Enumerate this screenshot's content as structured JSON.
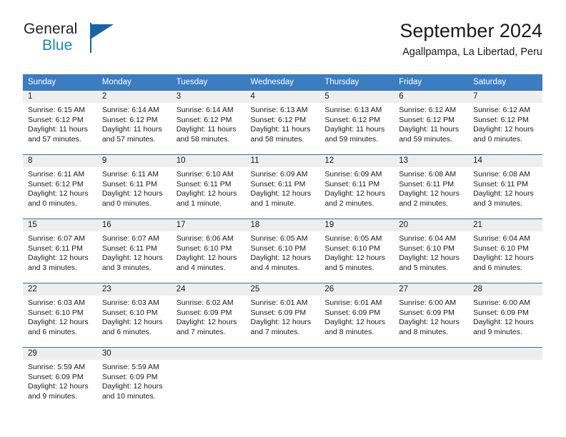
{
  "brand": {
    "name_line1": "General",
    "name_line2": "Blue",
    "logo_icon": "triangle-flag-icon",
    "accent_color": "#1565a8",
    "blue_text_color": "#1f7fc4"
  },
  "header": {
    "title": "September 2024",
    "subtitle": "Agallpampa, La Libertad, Peru"
  },
  "theme": {
    "header_row_color": "#3b7dc0",
    "day_band_color": "#eeeeee",
    "row_divider_color": "#2f6fb3"
  },
  "weekdays": [
    "Sunday",
    "Monday",
    "Tuesday",
    "Wednesday",
    "Thursday",
    "Friday",
    "Saturday"
  ],
  "weeks": [
    [
      {
        "day": "1",
        "sunrise": "Sunrise: 6:15 AM",
        "sunset": "Sunset: 6:12 PM",
        "daylight": "Daylight: 11 hours and 57 minutes."
      },
      {
        "day": "2",
        "sunrise": "Sunrise: 6:14 AM",
        "sunset": "Sunset: 6:12 PM",
        "daylight": "Daylight: 11 hours and 57 minutes."
      },
      {
        "day": "3",
        "sunrise": "Sunrise: 6:14 AM",
        "sunset": "Sunset: 6:12 PM",
        "daylight": "Daylight: 11 hours and 58 minutes."
      },
      {
        "day": "4",
        "sunrise": "Sunrise: 6:13 AM",
        "sunset": "Sunset: 6:12 PM",
        "daylight": "Daylight: 11 hours and 58 minutes."
      },
      {
        "day": "5",
        "sunrise": "Sunrise: 6:13 AM",
        "sunset": "Sunset: 6:12 PM",
        "daylight": "Daylight: 11 hours and 59 minutes."
      },
      {
        "day": "6",
        "sunrise": "Sunrise: 6:12 AM",
        "sunset": "Sunset: 6:12 PM",
        "daylight": "Daylight: 11 hours and 59 minutes."
      },
      {
        "day": "7",
        "sunrise": "Sunrise: 6:12 AM",
        "sunset": "Sunset: 6:12 PM",
        "daylight": "Daylight: 12 hours and 0 minutes."
      }
    ],
    [
      {
        "day": "8",
        "sunrise": "Sunrise: 6:11 AM",
        "sunset": "Sunset: 6:12 PM",
        "daylight": "Daylight: 12 hours and 0 minutes."
      },
      {
        "day": "9",
        "sunrise": "Sunrise: 6:11 AM",
        "sunset": "Sunset: 6:11 PM",
        "daylight": "Daylight: 12 hours and 0 minutes."
      },
      {
        "day": "10",
        "sunrise": "Sunrise: 6:10 AM",
        "sunset": "Sunset: 6:11 PM",
        "daylight": "Daylight: 12 hours and 1 minute."
      },
      {
        "day": "11",
        "sunrise": "Sunrise: 6:09 AM",
        "sunset": "Sunset: 6:11 PM",
        "daylight": "Daylight: 12 hours and 1 minute."
      },
      {
        "day": "12",
        "sunrise": "Sunrise: 6:09 AM",
        "sunset": "Sunset: 6:11 PM",
        "daylight": "Daylight: 12 hours and 2 minutes."
      },
      {
        "day": "13",
        "sunrise": "Sunrise: 6:08 AM",
        "sunset": "Sunset: 6:11 PM",
        "daylight": "Daylight: 12 hours and 2 minutes."
      },
      {
        "day": "14",
        "sunrise": "Sunrise: 6:08 AM",
        "sunset": "Sunset: 6:11 PM",
        "daylight": "Daylight: 12 hours and 3 minutes."
      }
    ],
    [
      {
        "day": "15",
        "sunrise": "Sunrise: 6:07 AM",
        "sunset": "Sunset: 6:11 PM",
        "daylight": "Daylight: 12 hours and 3 minutes."
      },
      {
        "day": "16",
        "sunrise": "Sunrise: 6:07 AM",
        "sunset": "Sunset: 6:11 PM",
        "daylight": "Daylight: 12 hours and 3 minutes."
      },
      {
        "day": "17",
        "sunrise": "Sunrise: 6:06 AM",
        "sunset": "Sunset: 6:10 PM",
        "daylight": "Daylight: 12 hours and 4 minutes."
      },
      {
        "day": "18",
        "sunrise": "Sunrise: 6:05 AM",
        "sunset": "Sunset: 6:10 PM",
        "daylight": "Daylight: 12 hours and 4 minutes."
      },
      {
        "day": "19",
        "sunrise": "Sunrise: 6:05 AM",
        "sunset": "Sunset: 6:10 PM",
        "daylight": "Daylight: 12 hours and 5 minutes."
      },
      {
        "day": "20",
        "sunrise": "Sunrise: 6:04 AM",
        "sunset": "Sunset: 6:10 PM",
        "daylight": "Daylight: 12 hours and 5 minutes."
      },
      {
        "day": "21",
        "sunrise": "Sunrise: 6:04 AM",
        "sunset": "Sunset: 6:10 PM",
        "daylight": "Daylight: 12 hours and 6 minutes."
      }
    ],
    [
      {
        "day": "22",
        "sunrise": "Sunrise: 6:03 AM",
        "sunset": "Sunset: 6:10 PM",
        "daylight": "Daylight: 12 hours and 6 minutes."
      },
      {
        "day": "23",
        "sunrise": "Sunrise: 6:03 AM",
        "sunset": "Sunset: 6:10 PM",
        "daylight": "Daylight: 12 hours and 6 minutes."
      },
      {
        "day": "24",
        "sunrise": "Sunrise: 6:02 AM",
        "sunset": "Sunset: 6:09 PM",
        "daylight": "Daylight: 12 hours and 7 minutes."
      },
      {
        "day": "25",
        "sunrise": "Sunrise: 6:01 AM",
        "sunset": "Sunset: 6:09 PM",
        "daylight": "Daylight: 12 hours and 7 minutes."
      },
      {
        "day": "26",
        "sunrise": "Sunrise: 6:01 AM",
        "sunset": "Sunset: 6:09 PM",
        "daylight": "Daylight: 12 hours and 8 minutes."
      },
      {
        "day": "27",
        "sunrise": "Sunrise: 6:00 AM",
        "sunset": "Sunset: 6:09 PM",
        "daylight": "Daylight: 12 hours and 8 minutes."
      },
      {
        "day": "28",
        "sunrise": "Sunrise: 6:00 AM",
        "sunset": "Sunset: 6:09 PM",
        "daylight": "Daylight: 12 hours and 9 minutes."
      }
    ],
    [
      {
        "day": "29",
        "sunrise": "Sunrise: 5:59 AM",
        "sunset": "Sunset: 6:09 PM",
        "daylight": "Daylight: 12 hours and 9 minutes."
      },
      {
        "day": "30",
        "sunrise": "Sunrise: 5:59 AM",
        "sunset": "Sunset: 6:09 PM",
        "daylight": "Daylight: 12 hours and 10 minutes."
      },
      {
        "day": "",
        "sunrise": "",
        "sunset": "",
        "daylight": ""
      },
      {
        "day": "",
        "sunrise": "",
        "sunset": "",
        "daylight": ""
      },
      {
        "day": "",
        "sunrise": "",
        "sunset": "",
        "daylight": ""
      },
      {
        "day": "",
        "sunrise": "",
        "sunset": "",
        "daylight": ""
      },
      {
        "day": "",
        "sunrise": "",
        "sunset": "",
        "daylight": ""
      }
    ]
  ]
}
